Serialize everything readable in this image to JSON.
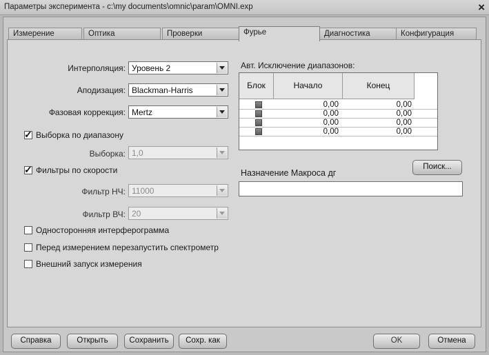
{
  "window": {
    "title": "Параметры эксперимента - c:\\my documents\\omnic\\param\\OMNI.exp",
    "close_icon": "close-icon"
  },
  "tabs": [
    {
      "label": "Измерение",
      "active": false
    },
    {
      "label": "Оптика",
      "active": false
    },
    {
      "label": "Проверки",
      "active": false
    },
    {
      "label": "Фурье",
      "active": true
    },
    {
      "label": "Диагностика",
      "active": false
    },
    {
      "label": "Конфигурация",
      "active": false
    }
  ],
  "left": {
    "interpolation": {
      "label": "Интерполяция:",
      "value": "Уровень 2"
    },
    "apodization": {
      "label": "Аподизация:",
      "value": "Blackman-Harris"
    },
    "phase_correction": {
      "label": "Фазовая коррекция:",
      "value": "Mertz"
    },
    "range_sampling": {
      "label": "Выборка по диапазону",
      "checked": true
    },
    "sampling": {
      "label": "Выборка:",
      "value": "1,0",
      "disabled": true
    },
    "speed_filters": {
      "label": "Фильтры по скорости",
      "checked": true
    },
    "lowpass": {
      "label": "Фильтр НЧ:",
      "value": "11000",
      "disabled": true
    },
    "highpass": {
      "label": "Фильтр ВЧ:",
      "value": "20",
      "disabled": true
    },
    "single_sided": {
      "label": "Односторонняя интерферограмма",
      "checked": false
    },
    "restart_spectrometer": {
      "label": "Перед измерением перезапустить спектрометр",
      "checked": false
    },
    "external_trigger": {
      "label": "Внешний запуск измерения",
      "checked": false
    }
  },
  "range_exclusion": {
    "title": "Авт. Исключение диапазонов:",
    "columns": [
      "Блок",
      "Начало",
      "Конец"
    ],
    "rows": [
      {
        "start": "0,00",
        "end": "0,00"
      },
      {
        "start": "0,00",
        "end": "0,00"
      },
      {
        "start": "0,00",
        "end": "0,00"
      },
      {
        "start": "0,00",
        "end": "0,00"
      }
    ]
  },
  "macro": {
    "label": "Назначение Макроса дг",
    "browse": "Поиск...",
    "value": ""
  },
  "buttons": {
    "help": "Справка",
    "open": "Открыть",
    "save": "Сохранить",
    "save_as": "Сохр. как",
    "ok": "OK",
    "cancel": "Отмена"
  }
}
